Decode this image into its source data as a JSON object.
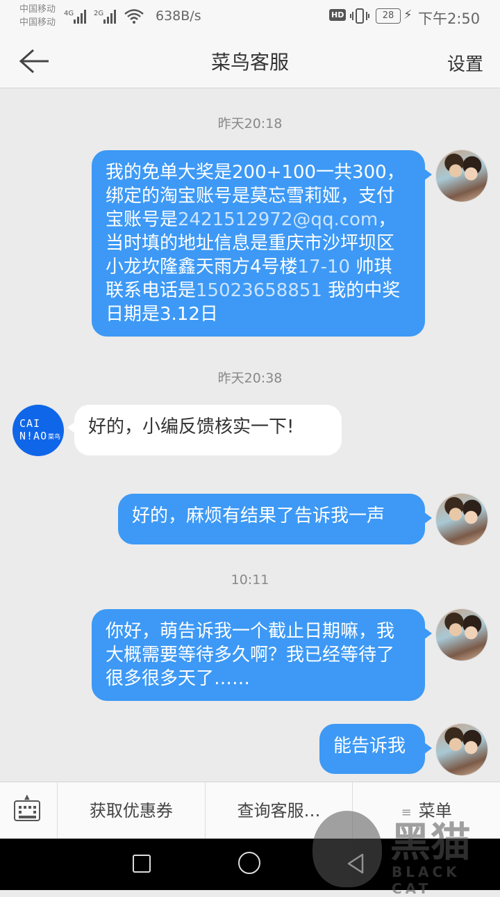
{
  "status_bar": {
    "carrier1": "中国移动",
    "carrier2": "中国移动",
    "net1": "4G",
    "net2": "2G",
    "speed": "638B/s",
    "hd": "HD",
    "battery": "28",
    "time": "下午2:50"
  },
  "header": {
    "title": "菜鸟客服",
    "settings": "设置"
  },
  "chat": {
    "messages": [
      {
        "time": "昨天20:18"
      },
      {
        "from": "me",
        "text_parts": [
          "我的免单大奖是200+100一共300，绑定的淘宝账号是莫忘雪莉娅，支付宝账号是",
          "2421512972@qq.com",
          "，当时填的地址信息是重庆市沙坪坝区小龙坎隆鑫天雨方4号楼",
          "17-10",
          " 帅琪 联系电话是",
          "15023658851",
          " 我的中奖日期是3.12日"
        ]
      },
      {
        "time": "昨天20:38"
      },
      {
        "from": "service",
        "text": "好的，小编反馈核实一下!"
      },
      {
        "from": "me",
        "text": "好的，麻烦有结果了告诉我一声"
      },
      {
        "time": "10:11"
      },
      {
        "from": "me",
        "text": "你好，萌告诉我一个截止日期嘛，我大概需要等待多久啊？我已经等待了很多很多天了……"
      },
      {
        "from": "me",
        "text": "能告诉我"
      }
    ],
    "service_avatar": {
      "line1": "CAI",
      "line2": "N!AO",
      "cn": "菜鸟"
    }
  },
  "menu": {
    "items": [
      "获取优惠券",
      "查询客服…",
      "菜单"
    ]
  },
  "watermark": {
    "text": "黑猫",
    "sub": "BLACK CAT"
  },
  "colors": {
    "bubble_me": "#3d99f5",
    "service_avatar": "#0f66e8"
  }
}
